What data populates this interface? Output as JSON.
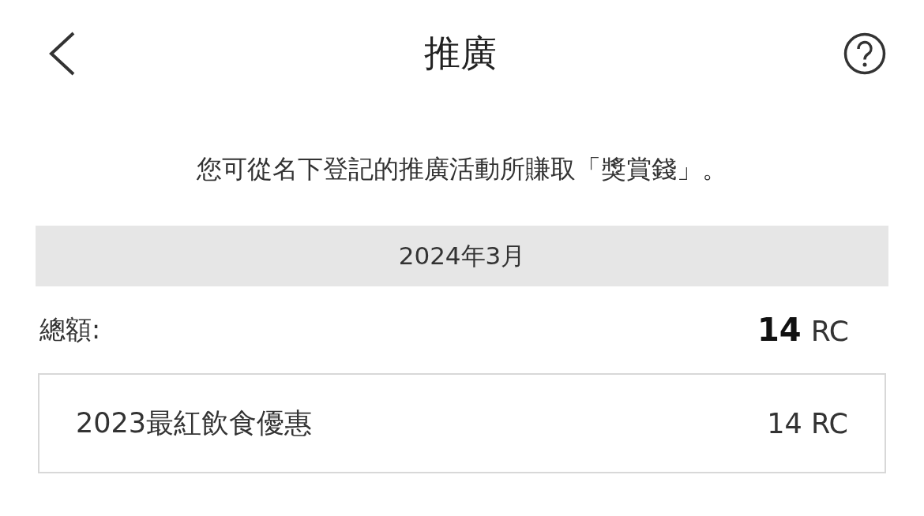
{
  "header": {
    "title": "推廣"
  },
  "description": "您可從名下登記的推廣活動所賺取「獎賞錢」。",
  "month": "2024年3月",
  "total": {
    "label": "總額:",
    "amount": "14",
    "unit": "RC"
  },
  "items": [
    {
      "name": "2023最紅飲食優惠",
      "amount": "14 RC"
    }
  ]
}
